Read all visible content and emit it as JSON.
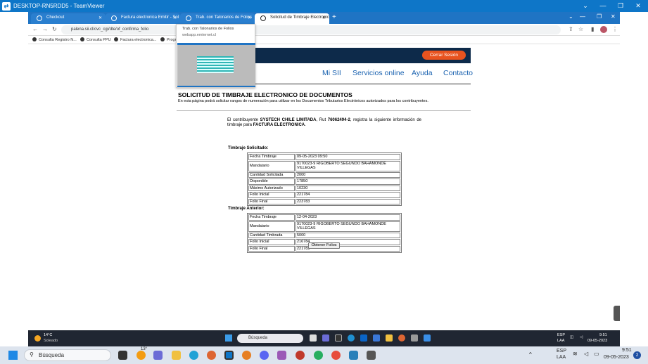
{
  "window": {
    "title": "DESKTOP-RN5RDD5 - TeamViewer"
  },
  "browser": {
    "tabs": [
      {
        "label": "Checkout"
      },
      {
        "label": "Factura electronica Emitir - Sol"
      },
      {
        "label": "Trab. con Talonarios de Folios"
      },
      {
        "label": "Solicitud de Timbraje Electronic"
      }
    ],
    "url": "palena.sii.cl/cvc_cgi/dte/of_confirma_folio",
    "bookmarks": [
      "Consulta Registro N...",
      "Consulta PPU",
      "Factura electronica...",
      "Progr"
    ]
  },
  "tooltip": {
    "title": "Trab. con Talonarios de Folios",
    "host": "webapp.emternet.cl"
  },
  "site": {
    "logout": "Cerrar Sesión",
    "menu": [
      "Mi SII",
      "Servicios online",
      "Ayuda",
      "Contacto"
    ]
  },
  "page": {
    "title": "SOLICITUD DE TIMBRAJE ELECTRONICO DE DOCUMENTOS",
    "subtitle": "En esta página podrá solicitar rangos de numeración para utilizar en los Documentos Tributarios Electrónicos autorizados para los contribuyentes.",
    "intro_prefix": "El contribuyente",
    "company": "SYSTECH CHILE LIMITADA",
    "intro_mid": ", Rut",
    "rut": "76062494-2",
    "intro_rest": ", registra la siguiente información de timbraje para",
    "doc_type": "FACTURA ELECTRONICA",
    "intro_end": ".",
    "requested_heading": "Timbraje Solicitado:",
    "requested": [
      {
        "label": "Fecha Timbraje",
        "value": "09-05-2023 09:50"
      },
      {
        "label": "Mandatario",
        "value": "9170023-9  RIGOBERTO SEGUNDO BAHAMONDE VILLEGAS"
      },
      {
        "label": "Cantidad Solicitada",
        "value": "2000"
      },
      {
        "label": "Disponible",
        "value": "17850"
      },
      {
        "label": "Máximo Autorizado",
        "value": "10230"
      },
      {
        "label": "Folio Inicial",
        "value": "221784"
      },
      {
        "label": "Folio Final",
        "value": "223783"
      }
    ],
    "previous_heading": "Timbraje Anterior:",
    "previous": [
      {
        "label": "Fecha Timbraje",
        "value": "12-04-2023"
      },
      {
        "label": "Mandatario",
        "value": "9170023-9  RIGOBERTO SEGUNDO BAHAMONDE VILLEGAS"
      },
      {
        "label": "Cantidad Timbrada",
        "value": "5000"
      },
      {
        "label": "Folio Inicial",
        "value": "216784"
      },
      {
        "label": "Folio Final",
        "value": "221783"
      }
    ],
    "button": "Obtener Folios"
  },
  "remote_taskbar": {
    "weather_temp": "14°C",
    "weather_desc": "Soleado",
    "search": "Búsqueda",
    "lang": "ESP",
    "lang2": "LAA",
    "time": "9:51",
    "date": "09-05-2023"
  },
  "local_taskbar": {
    "search": "Búsqueda",
    "badge": "13°",
    "lang": "ESP",
    "lang2": "LAA",
    "time": "9:51",
    "date": "09-05-2023",
    "notifications": "2"
  },
  "colors": {
    "teamviewer": "#0e76c8",
    "sii_header": "#0d2a4a",
    "logout": "#e8531f",
    "link": "#1a62b0"
  }
}
